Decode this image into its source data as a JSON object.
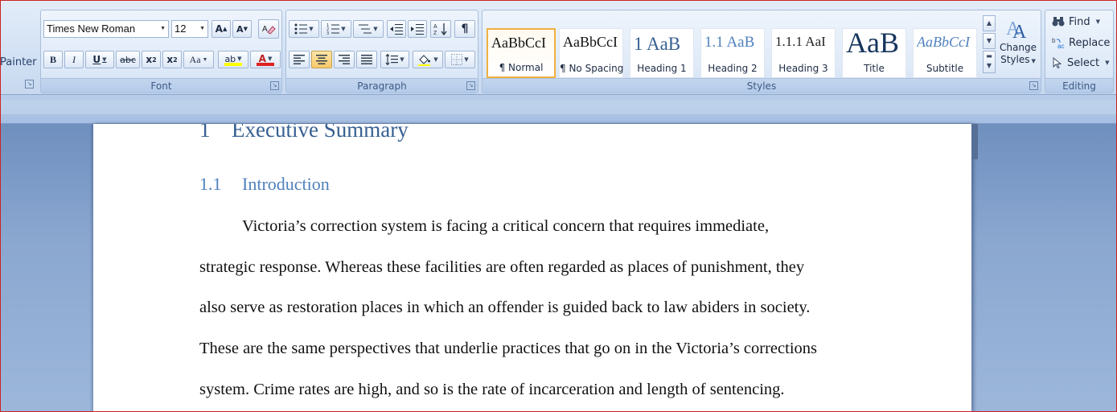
{
  "clipboard": {
    "painter_label": "Painter"
  },
  "font": {
    "group_label": "Font",
    "family": "Times New Roman",
    "size": "12",
    "grow_label": "A",
    "shrink_label": "A",
    "bold_label": "B",
    "italic_label": "I",
    "underline_label": "U",
    "strike_label": "abc",
    "subscript_label": "x",
    "subscript_suffix": "2",
    "superscript_label": "x",
    "superscript_suffix": "2",
    "case_label": "Aa",
    "highlight_label": "ab",
    "font_color_label": "A",
    "highlight_color": "#ffff00",
    "font_color": "#e02020"
  },
  "paragraph": {
    "group_label": "Paragraph"
  },
  "styles": {
    "group_label": "Styles",
    "tiles": [
      {
        "sample": "AaBbCcI",
        "name": "¶ Normal"
      },
      {
        "sample": "AaBbCcI",
        "name": "¶ No Spacing"
      },
      {
        "sample": "1  AaB",
        "name": "Heading 1"
      },
      {
        "sample": "1.1  AaB",
        "name": "Heading 2"
      },
      {
        "sample": "1.1.1  AaI",
        "name": "Heading 3"
      },
      {
        "sample": "AaB",
        "name": "Title"
      },
      {
        "sample": "AaBbCcI",
        "name": "Subtitle"
      }
    ],
    "change_styles_line1": "Change",
    "change_styles_line2": "Styles"
  },
  "editing": {
    "group_label": "Editing",
    "find_label": "Find",
    "replace_label": "Replace",
    "select_label": "Select"
  },
  "document": {
    "heading1_number": "1",
    "heading1_text": "Executive Summary",
    "heading2_number": "1.1",
    "heading2_text": "Introduction",
    "paragraph_lines": [
      "Victoria’s correction system is facing a critical concern that requires immediate,",
      "strategic response. Whereas these facilities are often regarded as places of punishment, they",
      "also serve as restoration places in which an offender is guided back to law abiders in society.",
      "These are the same perspectives that underlie practices that go on in the Victoria’s corrections",
      "system. Crime rates are high, and so is the rate of incarceration and length of sentencing."
    ]
  },
  "colors": {
    "heading1": "#365f91",
    "heading2": "#4f81bd",
    "ribbon_accent": "#3e5a86"
  }
}
